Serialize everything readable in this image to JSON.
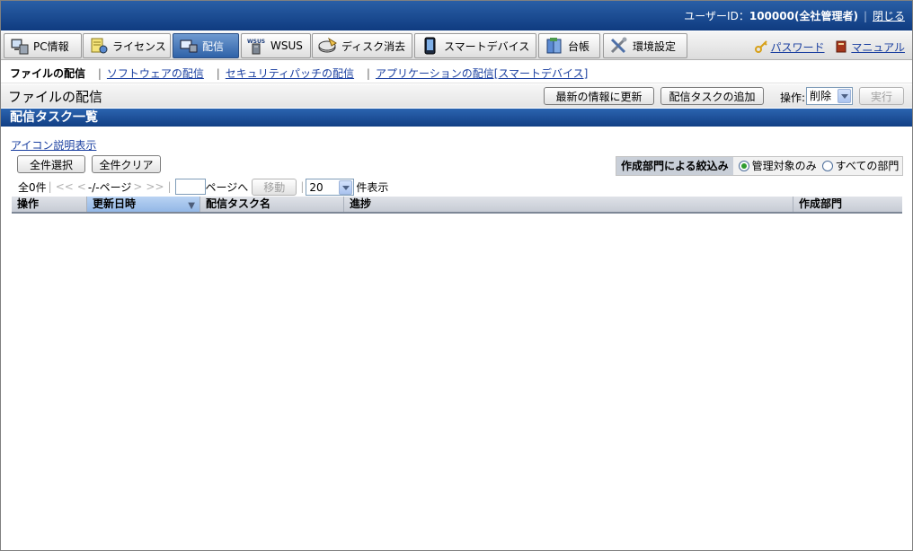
{
  "header": {
    "user_prefix": "ユーザーID：",
    "user_id": "100000",
    "user_role": "(全社管理者)",
    "close": "閉じる"
  },
  "tabs": [
    {
      "label": "PC情報",
      "icon": "pc-icon"
    },
    {
      "label": "ライセンス",
      "icon": "license-icon"
    },
    {
      "label": "配信",
      "icon": "delivery-icon",
      "active": true
    },
    {
      "label": "WSUS",
      "icon": "wsus-icon"
    },
    {
      "label": "ディスク消去",
      "icon": "disk-erase-icon"
    },
    {
      "label": "スマートデバイス",
      "icon": "smartphone-icon"
    },
    {
      "label": "台帳",
      "icon": "ledger-icon"
    },
    {
      "label": "環境設定",
      "icon": "tools-icon"
    }
  ],
  "right_links": {
    "password": "パスワード",
    "manual": "マニュアル"
  },
  "subnav": {
    "current": "ファイルの配信",
    "links": [
      "ソフトウェアの配信",
      "セキュリティパッチの配信",
      "アプリケーションの配信[スマートデバイス]"
    ]
  },
  "title": {
    "page_title": "ファイルの配信",
    "refresh": "最新の情報に更新",
    "add_task": "配信タスクの追加",
    "op_label": "操作:",
    "op_value": "削除",
    "run": "実行"
  },
  "section": {
    "title": "配信タスク一覧",
    "icon_legend": "アイコン説明表示",
    "select_all": "全件選択",
    "clear_all": "全件クリア"
  },
  "filter": {
    "label": "作成部門による絞込み",
    "option_managed": "管理対象のみ",
    "option_all": "すべての部門",
    "selected": "管理対象のみ"
  },
  "pager": {
    "total": "全0件",
    "nav_first": "<<",
    "nav_prev": "<",
    "page_status": "-/-ページ",
    "nav_next": ">",
    "nav_last": ">>",
    "page_to": "ページへ",
    "move": "移動",
    "per_page": "20",
    "per_page_suffix": "件表示"
  },
  "table": {
    "columns": [
      "操作",
      "更新日時",
      "配信タスク名",
      "進捗",
      "作成部門"
    ],
    "rows": []
  }
}
